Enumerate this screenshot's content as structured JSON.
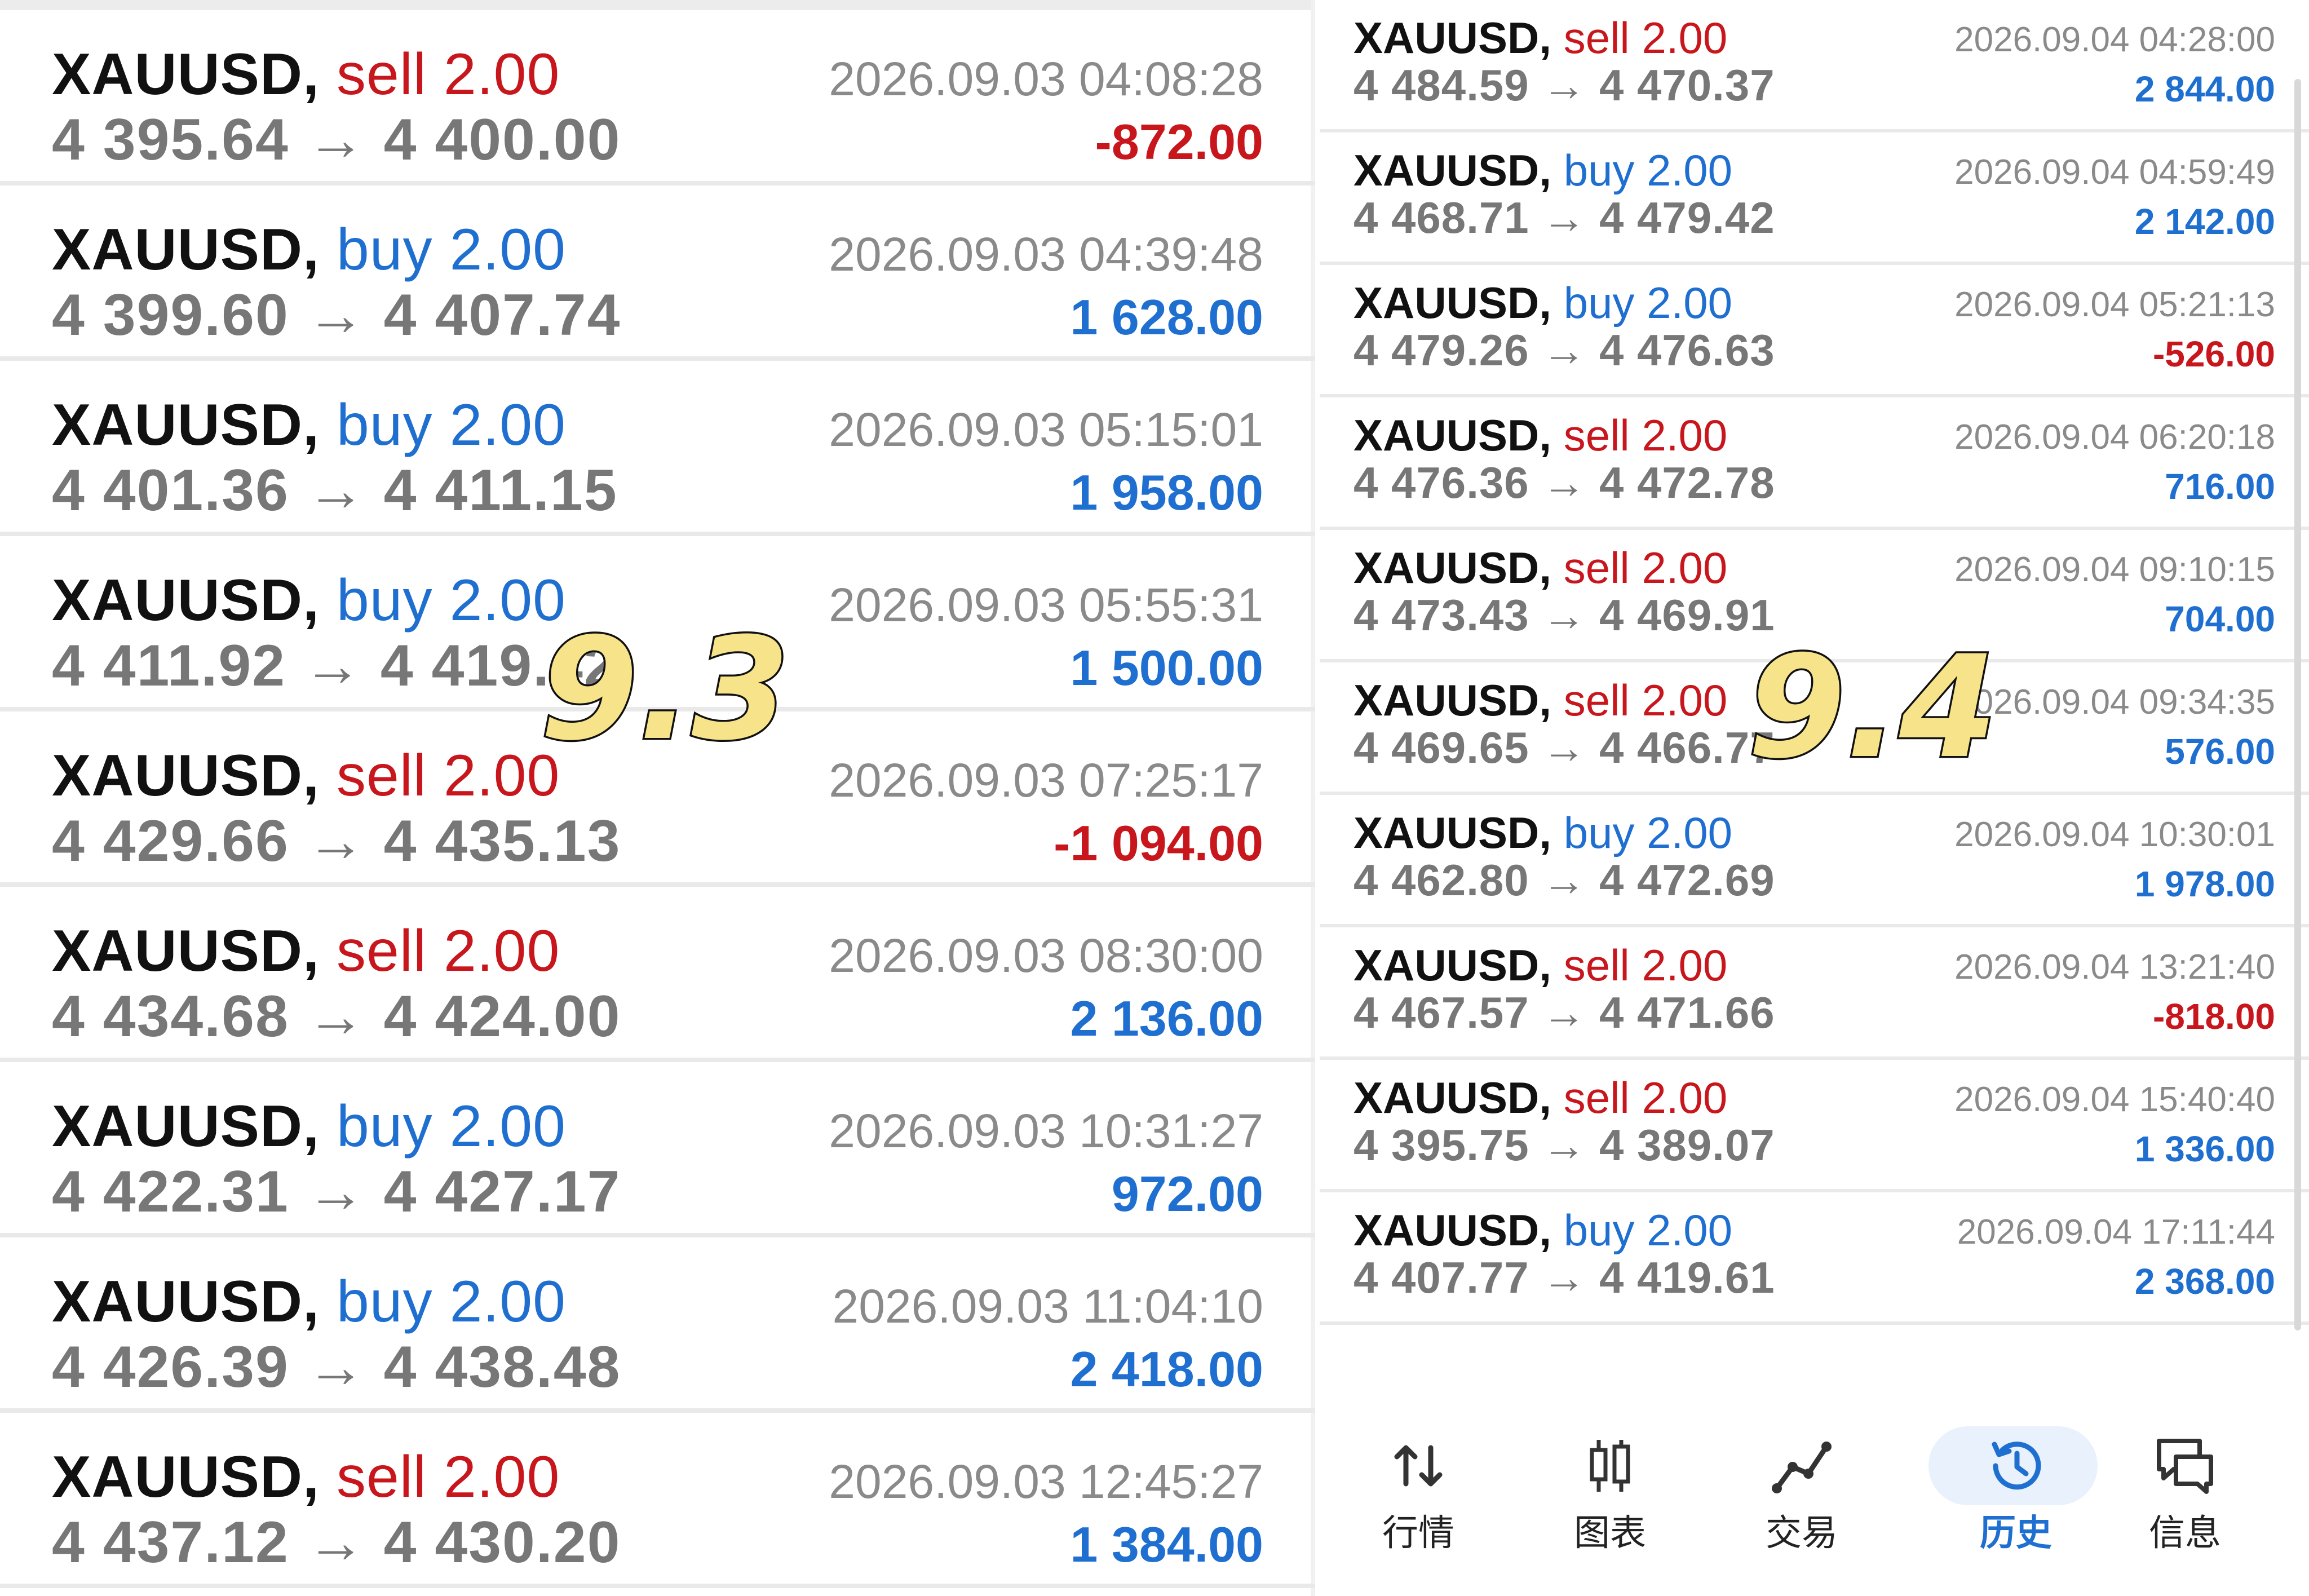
{
  "left_panel": {
    "stamp": "9.3",
    "trades": [
      {
        "symbol": "XAUUSD,",
        "side": "sell",
        "volume": "2.00",
        "open": "4 395.64",
        "close": "4 400.00",
        "time": "2026.09.03 04:08:28",
        "profit": "-872.00",
        "profit_sign": "neg"
      },
      {
        "symbol": "XAUUSD,",
        "side": "buy",
        "volume": "2.00",
        "open": "4 399.60",
        "close": "4 407.74",
        "time": "2026.09.03 04:39:48",
        "profit": "1 628.00",
        "profit_sign": "pos"
      },
      {
        "symbol": "XAUUSD,",
        "side": "buy",
        "volume": "2.00",
        "open": "4 401.36",
        "close": "4 411.15",
        "time": "2026.09.03 05:15:01",
        "profit": "1 958.00",
        "profit_sign": "pos"
      },
      {
        "symbol": "XAUUSD,",
        "side": "buy",
        "volume": "2.00",
        "open": "4 411.92",
        "close": "4 419.42",
        "time": "2026.09.03 05:55:31",
        "profit": "1 500.00",
        "profit_sign": "pos"
      },
      {
        "symbol": "XAUUSD,",
        "side": "sell",
        "volume": "2.00",
        "open": "4 429.66",
        "close": "4 435.13",
        "time": "2026.09.03 07:25:17",
        "profit": "-1 094.00",
        "profit_sign": "neg"
      },
      {
        "symbol": "XAUUSD,",
        "side": "sell",
        "volume": "2.00",
        "open": "4 434.68",
        "close": "4 424.00",
        "time": "2026.09.03 08:30:00",
        "profit": "2 136.00",
        "profit_sign": "pos"
      },
      {
        "symbol": "XAUUSD,",
        "side": "buy",
        "volume": "2.00",
        "open": "4 422.31",
        "close": "4 427.17",
        "time": "2026.09.03 10:31:27",
        "profit": "972.00",
        "profit_sign": "pos"
      },
      {
        "symbol": "XAUUSD,",
        "side": "buy",
        "volume": "2.00",
        "open": "4 426.39",
        "close": "4 438.48",
        "time": "2026.09.03 11:04:10",
        "profit": "2 418.00",
        "profit_sign": "pos"
      },
      {
        "symbol": "XAUUSD,",
        "side": "sell",
        "volume": "2.00",
        "open": "4 437.12",
        "close": "4 430.20",
        "time": "2026.09.03 12:45:27",
        "profit": "1 384.00",
        "profit_sign": "pos"
      }
    ]
  },
  "right_panel": {
    "stamp": "9.4",
    "trades": [
      {
        "symbol": "XAUUSD,",
        "side": "sell",
        "volume": "2.00",
        "open": "4 484.59",
        "close": "4 470.37",
        "time": "2026.09.04 04:28:00",
        "profit": "2 844.00",
        "profit_sign": "pos"
      },
      {
        "symbol": "XAUUSD,",
        "side": "buy",
        "volume": "2.00",
        "open": "4 468.71",
        "close": "4 479.42",
        "time": "2026.09.04 04:59:49",
        "profit": "2 142.00",
        "profit_sign": "pos"
      },
      {
        "symbol": "XAUUSD,",
        "side": "buy",
        "volume": "2.00",
        "open": "4 479.26",
        "close": "4 476.63",
        "time": "2026.09.04 05:21:13",
        "profit": "-526.00",
        "profit_sign": "neg"
      },
      {
        "symbol": "XAUUSD,",
        "side": "sell",
        "volume": "2.00",
        "open": "4 476.36",
        "close": "4 472.78",
        "time": "2026.09.04 06:20:18",
        "profit": "716.00",
        "profit_sign": "pos"
      },
      {
        "symbol": "XAUUSD,",
        "side": "sell",
        "volume": "2.00",
        "open": "4 473.43",
        "close": "4 469.91",
        "time": "2026.09.04 09:10:15",
        "profit": "704.00",
        "profit_sign": "pos"
      },
      {
        "symbol": "XAUUSD,",
        "side": "sell",
        "volume": "2.00",
        "open": "4 469.65",
        "close": "4 466.77",
        "time": "2026.09.04 09:34:35",
        "profit": "576.00",
        "profit_sign": "pos"
      },
      {
        "symbol": "XAUUSD,",
        "side": "buy",
        "volume": "2.00",
        "open": "4 462.80",
        "close": "4 472.69",
        "time": "2026.09.04 10:30:01",
        "profit": "1 978.00",
        "profit_sign": "pos"
      },
      {
        "symbol": "XAUUSD,",
        "side": "sell",
        "volume": "2.00",
        "open": "4 467.57",
        "close": "4 471.66",
        "time": "2026.09.04 13:21:40",
        "profit": "-818.00",
        "profit_sign": "neg"
      },
      {
        "symbol": "XAUUSD,",
        "side": "sell",
        "volume": "2.00",
        "open": "4 395.75",
        "close": "4 389.07",
        "time": "2026.09.04 15:40:40",
        "profit": "1 336.00",
        "profit_sign": "pos"
      },
      {
        "symbol": "XAUUSD,",
        "side": "buy",
        "volume": "2.00",
        "open": "4 407.77",
        "close": "4 419.61",
        "time": "2026.09.04 17:11:44",
        "profit": "2 368.00",
        "profit_sign": "pos"
      }
    ]
  },
  "arrow": "→",
  "bottom_nav": {
    "items": [
      {
        "label": "行情",
        "icon": "quotes-arrows-icon"
      },
      {
        "label": "图表",
        "icon": "candlestick-chart-icon"
      },
      {
        "label": "交易",
        "icon": "trade-line-icon"
      },
      {
        "label": "历史",
        "icon": "history-clock-icon",
        "active": true
      },
      {
        "label": "信息",
        "icon": "messages-chat-icon"
      }
    ]
  },
  "colors": {
    "sell": "#c8161d",
    "buy": "#1f6fd0",
    "profit_pos": "#1f6fd0",
    "profit_neg": "#c8161d",
    "stamp_fill": "#f7e38a"
  }
}
